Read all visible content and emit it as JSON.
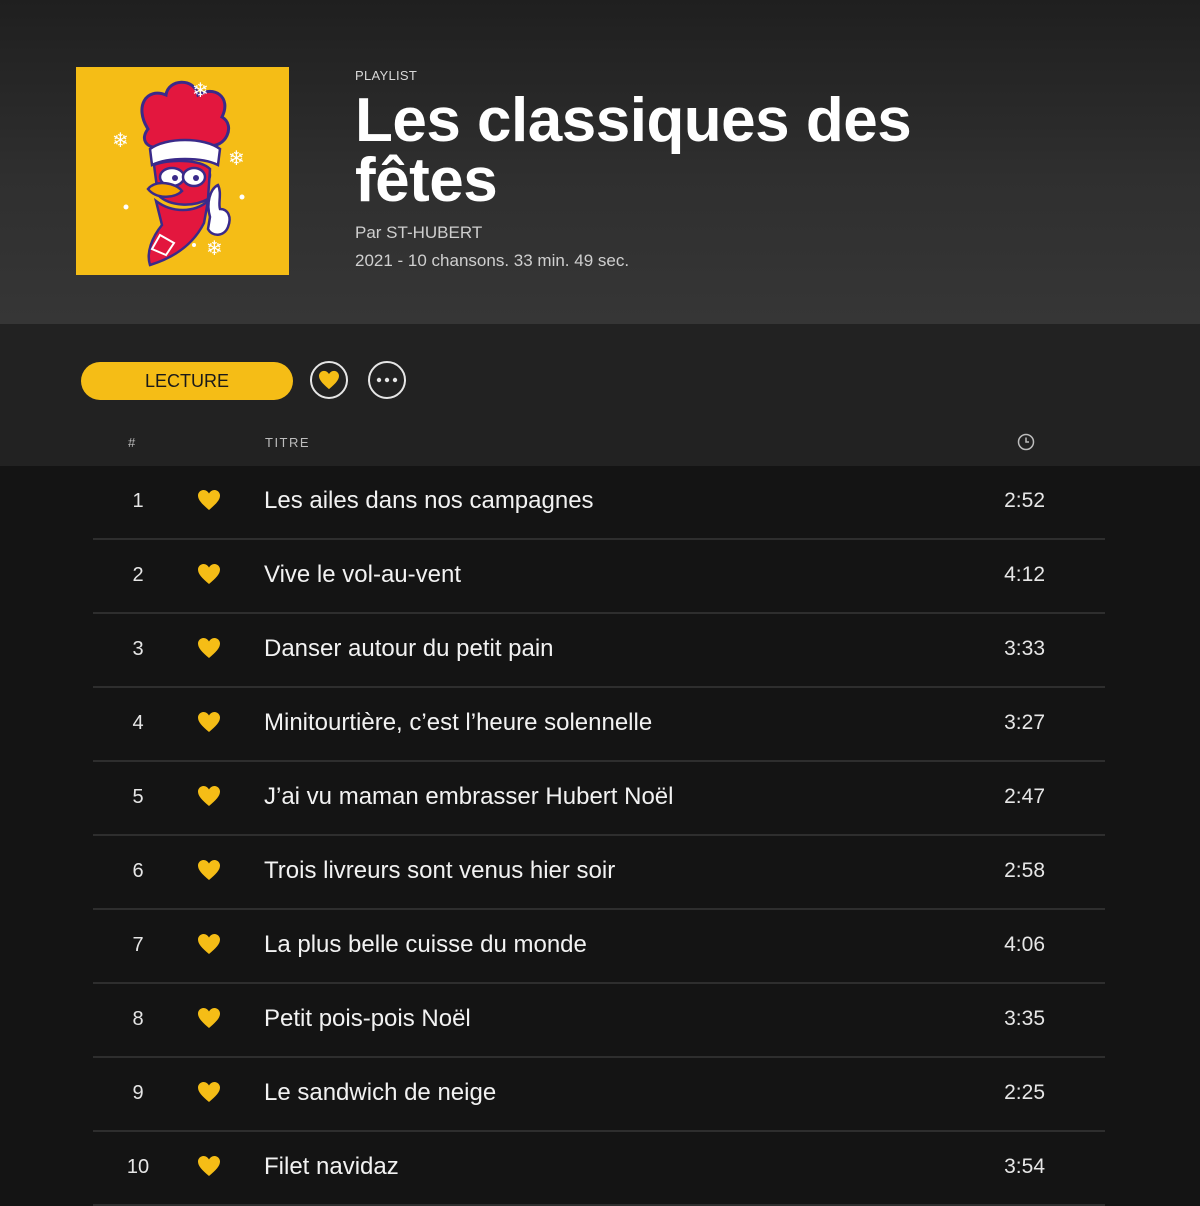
{
  "playlist": {
    "kind": "PLAYLIST",
    "title": "Les classiques des fêtes",
    "owner": "Par ST-HUBERT",
    "stats": "2021 - 10 chansons. 33 min. 49 sec.",
    "cover_icon": "rooster-santa-mascot"
  },
  "controls": {
    "play_label": "LECTURE",
    "like_icon": "heart-icon",
    "more_icon": "ellipsis-icon"
  },
  "columns": {
    "number": "#",
    "title": "TITRE",
    "duration_icon": "clock-icon"
  },
  "colors": {
    "accent": "#f5bd16",
    "background": "#141414",
    "header": "#2f2f2f"
  },
  "tracks": [
    {
      "number": "1",
      "title": "Les ailes dans nos campagnes",
      "duration": "2:52"
    },
    {
      "number": "2",
      "title": "Vive le vol-au-vent",
      "duration": "4:12"
    },
    {
      "number": "3",
      "title": "Danser autour du petit pain",
      "duration": "3:33"
    },
    {
      "number": "4",
      "title": "Minitourtière, c’est l’heure solennelle",
      "duration": "3:27"
    },
    {
      "number": "5",
      "title": "J’ai vu maman embrasser Hubert Noël",
      "duration": "2:47"
    },
    {
      "number": "6",
      "title": "Trois livreurs sont venus hier soir",
      "duration": "2:58"
    },
    {
      "number": "7",
      "title": "La plus belle cuisse du monde",
      "duration": "4:06"
    },
    {
      "number": "8",
      "title": "Petit pois-pois Noël",
      "duration": "3:35"
    },
    {
      "number": "9",
      "title": "Le sandwich de neige",
      "duration": "2:25"
    },
    {
      "number": "10",
      "title": "Filet navidaz",
      "duration": "3:54"
    }
  ]
}
